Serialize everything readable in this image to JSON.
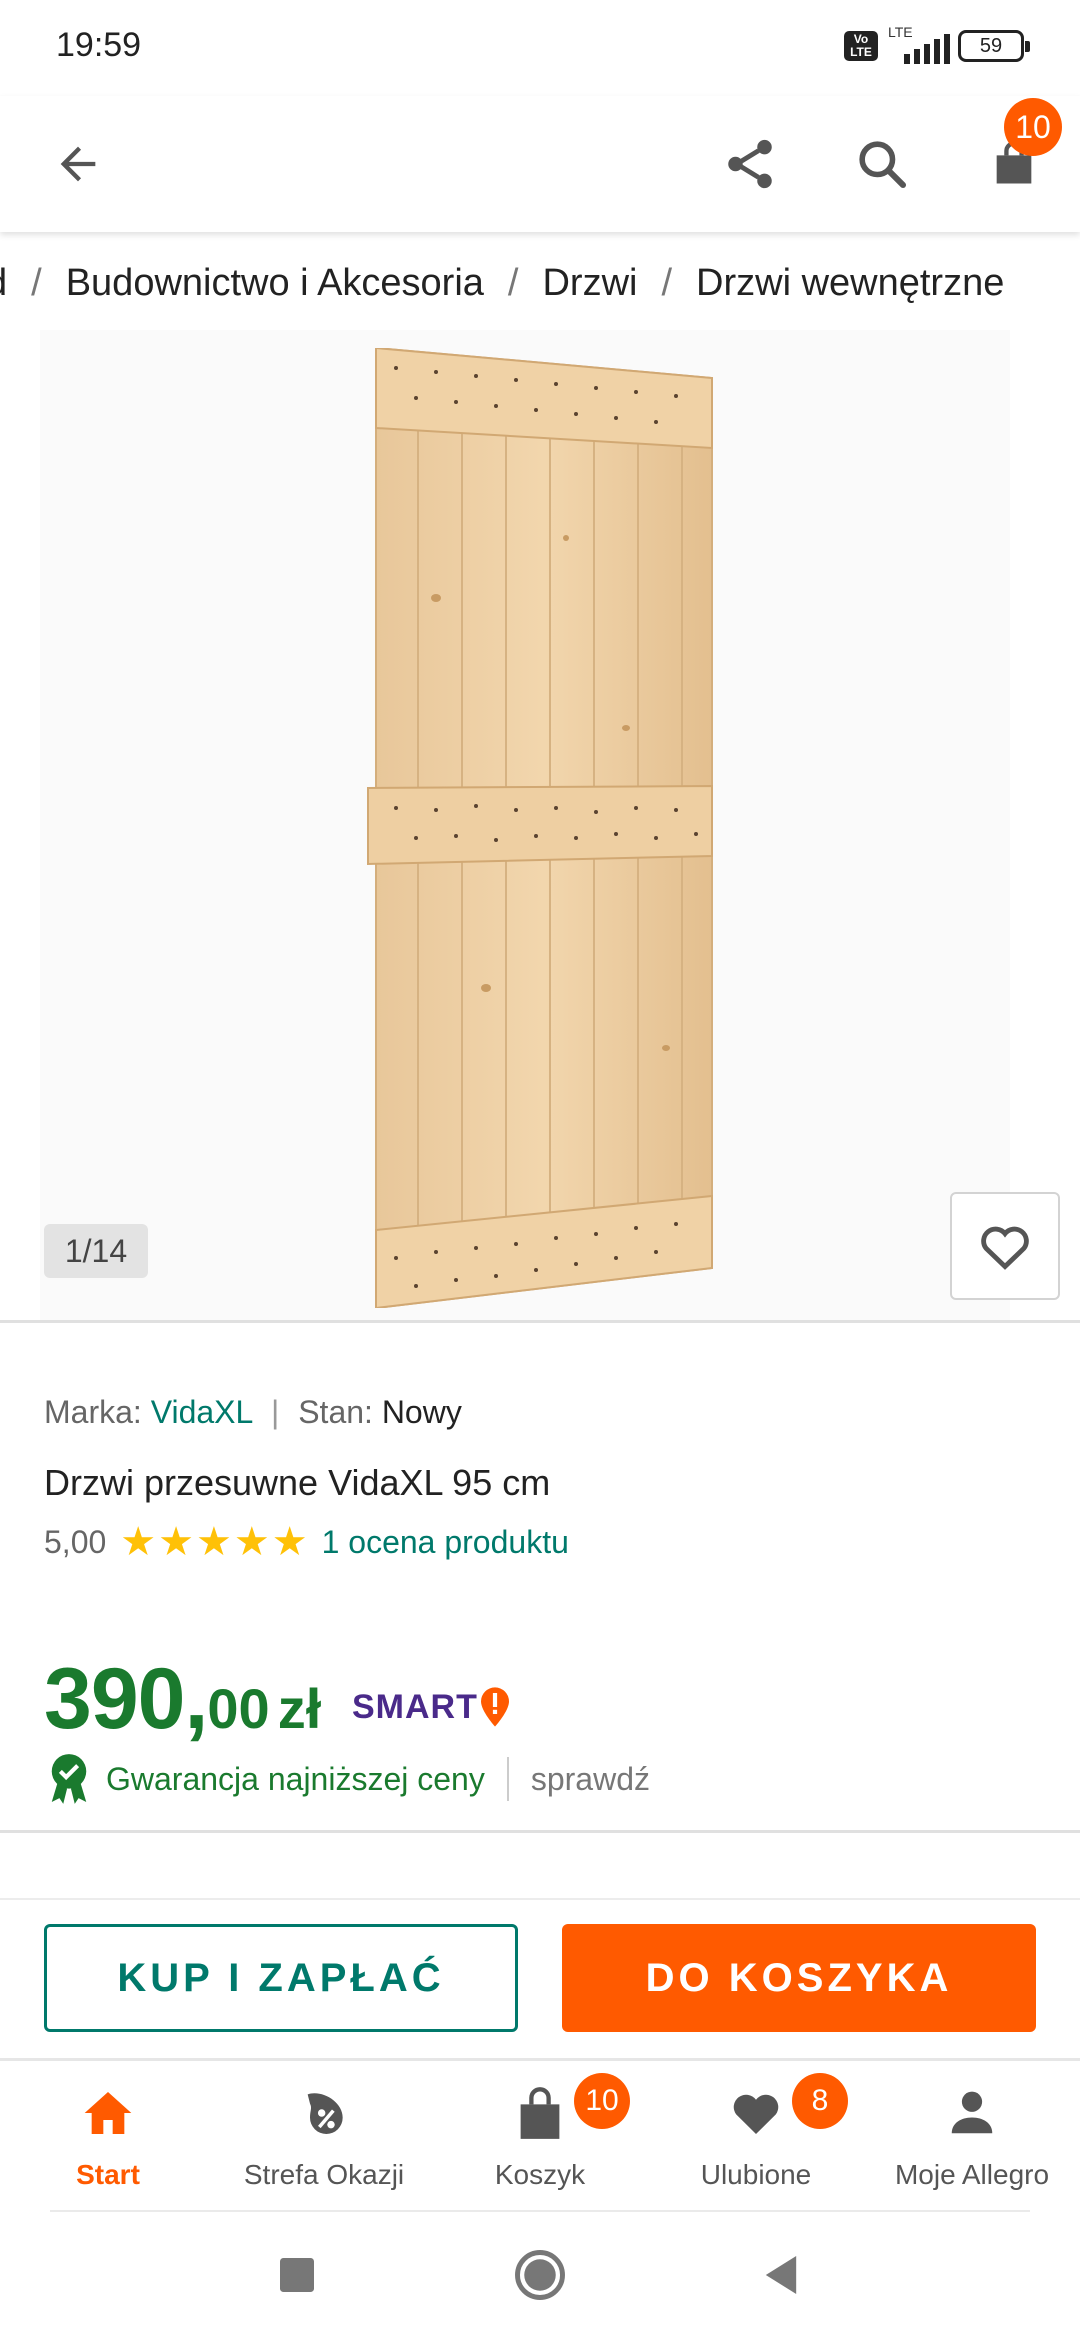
{
  "status_bar": {
    "time": "19:59",
    "volte": "Vo LTE",
    "network": "LTE",
    "battery": "59"
  },
  "app_bar": {
    "cart_count": "10"
  },
  "breadcrumb": [
    "d",
    "Budownictwo i Akcesoria",
    "Drzwi",
    "Drzwi wewnętrzne"
  ],
  "gallery": {
    "counter": "1/14"
  },
  "product": {
    "brand_label": "Marka:",
    "brand": "VidaXL",
    "condition_label": "Stan:",
    "condition": "Nowy",
    "title": "Drzwi przesuwne VidaXL 95 cm",
    "rating_value": "5,00",
    "rating_stars": 5,
    "rating_text": "1 ocena produktu"
  },
  "price": {
    "integer": "390,",
    "fraction": "00",
    "currency": "zł",
    "badge": "SMART!",
    "guarantee": "Gwarancja najniższej ceny",
    "check": "sprawdź"
  },
  "actions": {
    "buy_now": "KUP I ZAPŁAĆ",
    "add_to_cart": "DO KOSZYKA"
  },
  "bottom_nav": {
    "items": [
      {
        "label": "Start",
        "icon": "home-icon",
        "active": true
      },
      {
        "label": "Strefa Okazji",
        "icon": "deals-icon"
      },
      {
        "label": "Koszyk",
        "icon": "bag-icon",
        "badge": "10"
      },
      {
        "label": "Ulubione",
        "icon": "heart-icon",
        "badge": "8"
      },
      {
        "label": "Moje Allegro",
        "icon": "user-icon"
      }
    ]
  },
  "colors": {
    "accent": "#ff5a00",
    "brand_link": "#00796b",
    "price": "#1a7a2e",
    "star": "#ffc107",
    "smart": "#4a2a8a"
  }
}
